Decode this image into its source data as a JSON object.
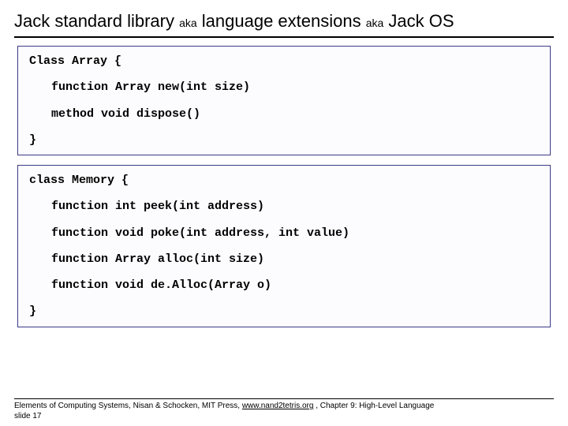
{
  "title": {
    "part1": "Jack standard library ",
    "aka1": "aka",
    "part2": " language extensions ",
    "aka2": "aka",
    "part3": " Jack OS"
  },
  "box1": {
    "l1": "Class Array {",
    "l2": "function Array new(int size)",
    "l3": "method void dispose()",
    "l4": "}"
  },
  "box2": {
    "l1": "class Memory {",
    "l2": "function int peek(int address)",
    "l3": "function void poke(int address, int value)",
    "l4": "function Array alloc(int size)",
    "l5": "function void de.Alloc(Array o)",
    "l6": "}"
  },
  "footer": {
    "text_before_link": "Elements of Computing Systems, Nisan & Schocken, MIT Press, ",
    "link_text": "www.nand2tetris.org",
    "text_after_link": " , Chapter 9: High-Level Language",
    "slide_line": "slide 17"
  }
}
